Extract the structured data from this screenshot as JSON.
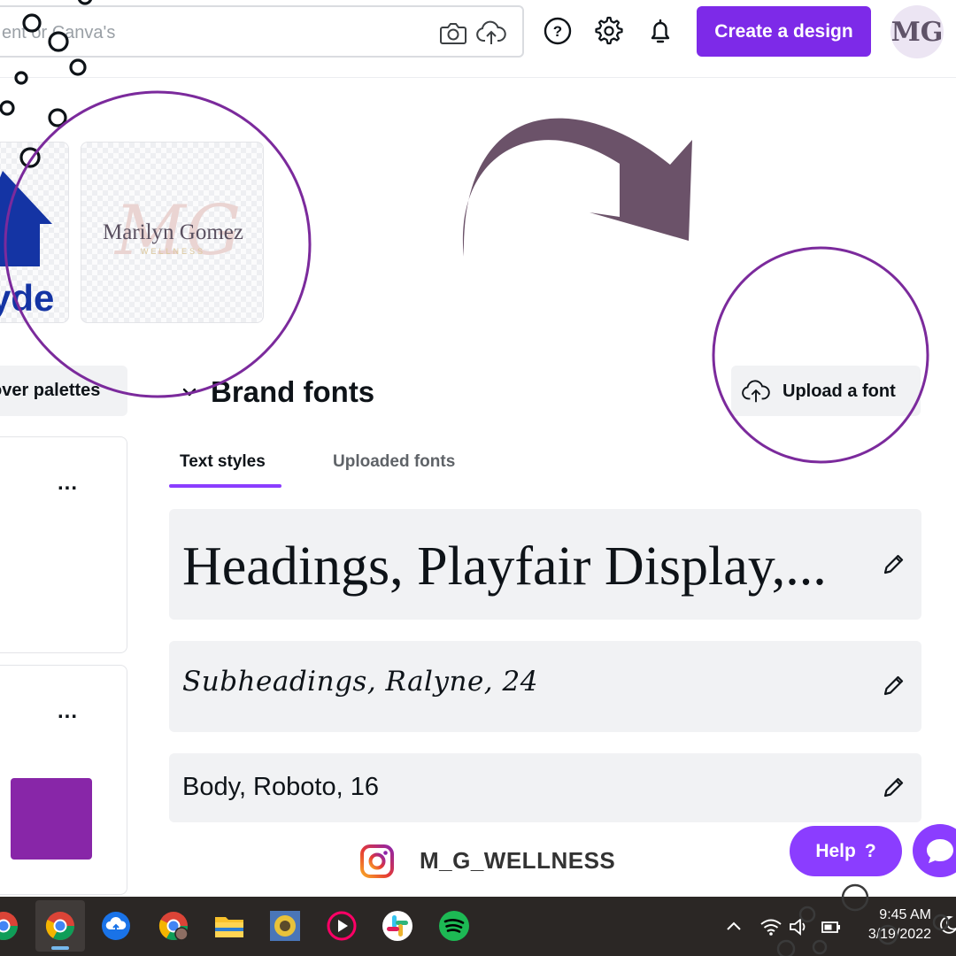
{
  "header": {
    "search_placeholder": "ent or Canva's",
    "create_label": "Create a design",
    "avatar_initials": "MG"
  },
  "logos": {
    "logo_a_text": "yde",
    "logo_b_name": "Marilyn Gomez",
    "logo_b_sub": "WELLNESS"
  },
  "palettes": {
    "discover_label": "over palettes",
    "more_label": "...",
    "swatch_color": "#8826a8"
  },
  "brand_fonts": {
    "title": "Brand fonts",
    "upload_label": "Upload a font",
    "tabs": [
      {
        "label": "Text styles",
        "active": true
      },
      {
        "label": "Uploaded fonts",
        "active": false
      }
    ],
    "styles": [
      {
        "label": "Headings, Playfair Display,..."
      },
      {
        "label": "Subheadings, Ralyne, 24"
      },
      {
        "label": "Body, Roboto, 16"
      }
    ]
  },
  "help": {
    "label": "Help",
    "question": "?"
  },
  "social": {
    "instagram_handle": "M_G_WELLNESS"
  },
  "taskbar": {
    "time": "9:45 AM",
    "date": "3/19/2022",
    "apps": [
      "chrome-app-icon",
      "google-drive-icon",
      "chrome-profile-icon",
      "file-explorer-icon",
      "photos-app-icon",
      "media-player-icon",
      "slack-icon",
      "spotify-icon"
    ]
  },
  "colors": {
    "accent": "#8b3dff",
    "create_button": "#7d2ae8",
    "annotation_circle": "#7b2a9c",
    "annotation_arrow": "#6b5269"
  }
}
